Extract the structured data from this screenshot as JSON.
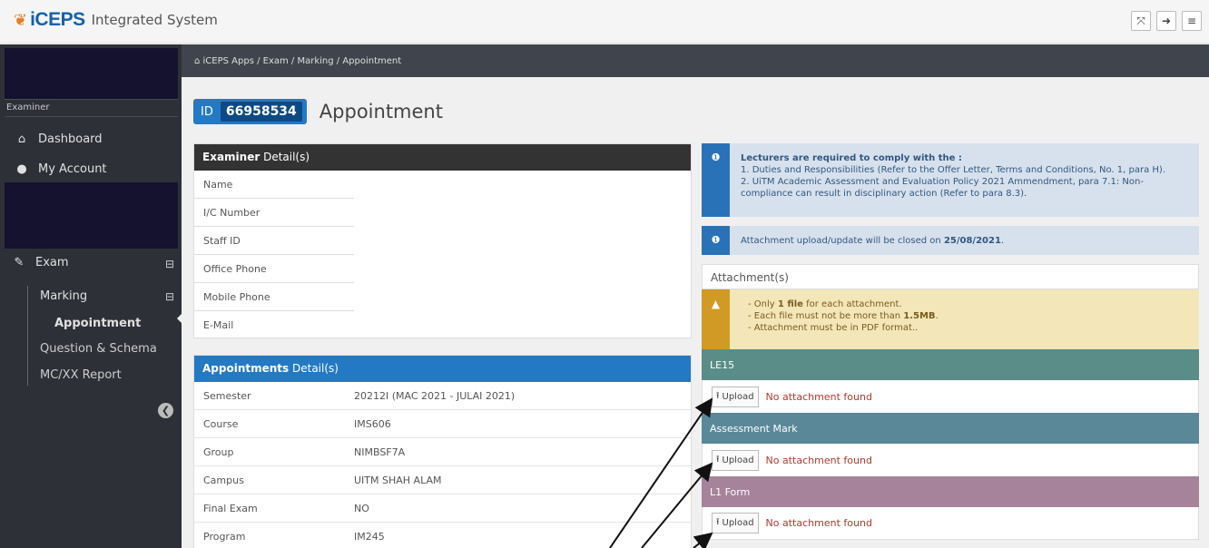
{
  "app": {
    "logo_mark": "❦",
    "brand": "iCEPS",
    "subtitle": "Integrated System"
  },
  "topbar_buttons": [
    {
      "icon": "fullscreen-icon",
      "glyph": "⤧"
    },
    {
      "icon": "logout-icon",
      "glyph": "➜"
    },
    {
      "icon": "menu-icon",
      "glyph": "≡"
    }
  ],
  "sidebar": {
    "role_label": "Examiner",
    "items": [
      {
        "label": "Dashboard",
        "icon": "home-icon",
        "glyph": "⌂"
      },
      {
        "label": "My Account",
        "icon": "user-icon",
        "glyph": "●"
      }
    ],
    "exam": {
      "label": "Exam",
      "icon": "edit-icon",
      "glyph": "✎",
      "toggle": "⊟"
    },
    "marking": {
      "label": "Marking",
      "toggle": "⊟"
    },
    "appointment": {
      "label": "Appointment"
    },
    "question": {
      "label": "Question & Schema"
    },
    "report": {
      "label": "MC/XX Report"
    },
    "collapse_glyph": "❮"
  },
  "breadcrumb": "⌂ iCEPS Apps / Exam / Marking / Appointment",
  "page": {
    "id_label": "ID",
    "id_value": "66958534",
    "title": "Appointment"
  },
  "examiner": {
    "title_bold": "Examiner",
    "title_rest": " Detail(s)",
    "fields": [
      "Name",
      "I/C Number",
      "Staff ID",
      "Office Phone",
      "Mobile Phone",
      "E-Mail"
    ]
  },
  "appointments": {
    "title_bold": "Appointments",
    "title_rest": " Detail(s)",
    "rows": [
      {
        "k": "Semester",
        "v": "20212I (MAC 2021 - JULAI 2021)"
      },
      {
        "k": "Course",
        "v": "IMS606"
      },
      {
        "k": "Group",
        "v": "NIMBSF7A"
      },
      {
        "k": "Campus",
        "v": "UITM SHAH ALAM"
      },
      {
        "k": "Final Exam",
        "v": "NO"
      },
      {
        "k": "Program",
        "v": "IM245"
      }
    ]
  },
  "notice": {
    "head": "Lecturers are required to comply with the :",
    "line1": "1. Duties and Responsibilities (Refer to the Offer Letter, Terms and Conditions, No. 1, para H).",
    "line2": "2. UiTM Academic Assessment and Evaluation Policy 2021 Ammendment, para 7.1: Non-",
    "line3": "compliance can result in disciplinary action (Refer to para 8.3)."
  },
  "close_notice": {
    "text": "Attachment upload/update will be closed on ",
    "date": "25/08/2021",
    "end": "."
  },
  "attachment": {
    "title": "Attachment(s)",
    "warn1a": "- Only ",
    "warn1b": "1 file",
    "warn1c": " for each attachment.",
    "warn2a": "- Each file must not be more than ",
    "warn2b": "1.5MB",
    "warn2c": ".",
    "warn3": "- Attachment must be in PDF format..",
    "sections": [
      {
        "title": "LE15",
        "color": "#5a8d88",
        "upload": "Upload",
        "status": "No attachment found"
      },
      {
        "title": "Assessment Mark",
        "color": "#5a8899",
        "upload": "Upload",
        "status": "No attachment found"
      },
      {
        "title": "L1 Form",
        "color": "#a6829b",
        "upload": "Upload",
        "status": "No attachment found"
      }
    ]
  },
  "colors": {
    "examiner_head": "#333333",
    "appointments_head": "#2479c4",
    "sidebar_bg": "#2e3037",
    "breadcrumb_bg": "#40454d"
  }
}
